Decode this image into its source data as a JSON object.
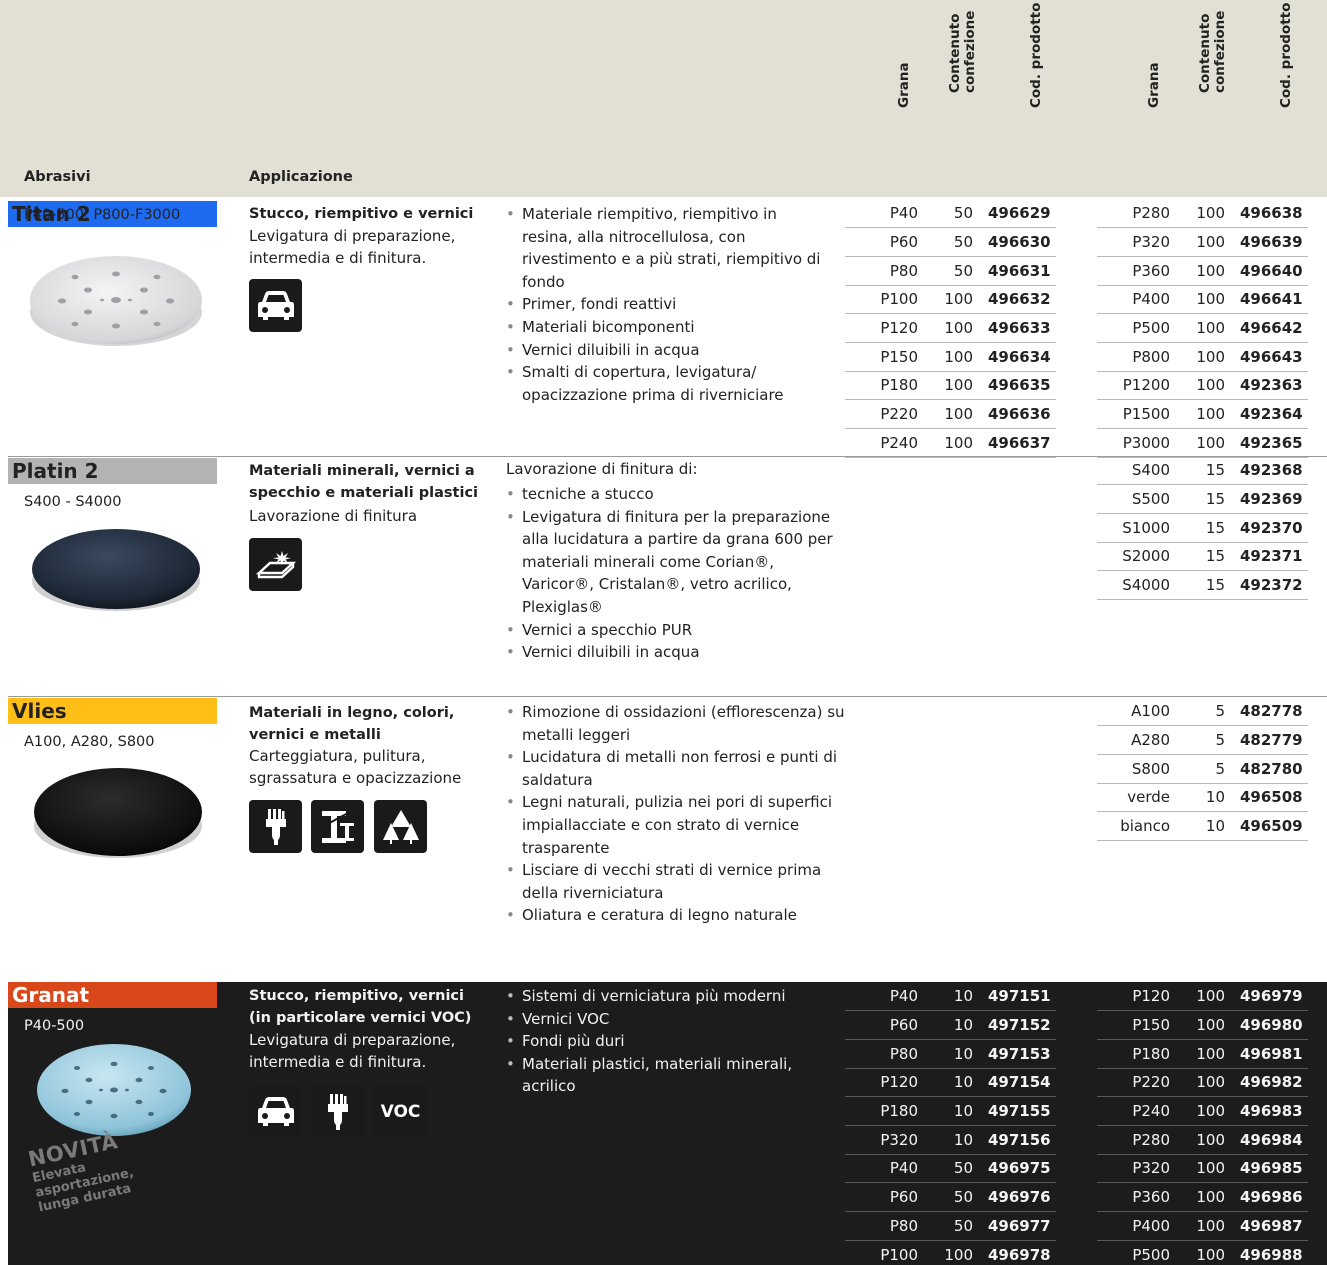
{
  "header": {
    "group1": {
      "grana": "Grana",
      "contenuto": "Contenuto\nconfezione",
      "codice": "Cod. prodotto"
    },
    "group2": {
      "grana": "Grana",
      "contenuto": "Contenuto\nconfezione",
      "codice": "Cod. prodotto"
    },
    "col_abrasivi": "Abrasivi",
    "col_applicazione": "Applicazione"
  },
  "colors": {
    "header_bg": "#e2e0d5",
    "titan_accent": "#1f6bf0",
    "platin_accent": "#b3b3b3",
    "vlies_accent": "#ffbf17",
    "granat_accent": "#d8481b",
    "granat_bg": "#1c1c1c"
  },
  "products": {
    "titan": {
      "name": "Titan 2",
      "grit_range": "P40-500, P800-F3000",
      "app_title": "Stucco, riempitivo e vernici",
      "app_desc": "Levigatura di preparazione, intermedia e di finitura.",
      "icons": [
        "car-icon"
      ],
      "bullets": [
        "Materiale riempitivo, riempitivo in resina, alla nitrocellulosa, con rivestimento e a più strati, riempitivo di fondo",
        "Primer, fondi reattivi",
        "Materiali bicomponenti",
        "Vernici diluibili in acqua",
        "Smalti di copertura, levigatura/ opacizzazione prima di riverniciare"
      ],
      "rows_left": [
        [
          "P40",
          "50",
          "496629"
        ],
        [
          "P60",
          "50",
          "496630"
        ],
        [
          "P80",
          "50",
          "496631"
        ],
        [
          "P100",
          "100",
          "496632"
        ],
        [
          "P120",
          "100",
          "496633"
        ],
        [
          "P150",
          "100",
          "496634"
        ],
        [
          "P180",
          "100",
          "496635"
        ],
        [
          "P220",
          "100",
          "496636"
        ],
        [
          "P240",
          "100",
          "496637"
        ]
      ],
      "rows_right": [
        [
          "P280",
          "100",
          "496638"
        ],
        [
          "P320",
          "100",
          "496639"
        ],
        [
          "P360",
          "100",
          "496640"
        ],
        [
          "P400",
          "100",
          "496641"
        ],
        [
          "P500",
          "100",
          "496642"
        ],
        [
          "P800",
          "100",
          "496643"
        ],
        [
          "P1200",
          "100",
          "492363"
        ],
        [
          "P1500",
          "100",
          "492364"
        ],
        [
          "P3000",
          "100",
          "492365"
        ]
      ]
    },
    "platin": {
      "name": "Platin 2",
      "grit_range": "S400 - S4000",
      "app_title": "Materiali minerali, vernici a specchio e materiali plastici",
      "app_desc": "Lavorazione di finitura",
      "icons": [
        "polish-surface-icon"
      ],
      "intro": "Lavorazione di finitura di:",
      "bullets": [
        "tecniche a stucco",
        "Levigatura di finitura per la preparazione alla lucidatura a partire da grana 600 per materiali minerali come Corian®, Varicor®, Cristalan®, vetro acrilico, Plexiglas®",
        "Vernici a specchio PUR",
        "Vernici diluibili in acqua"
      ],
      "rows_right": [
        [
          "S400",
          "15",
          "492368"
        ],
        [
          "S500",
          "15",
          "492369"
        ],
        [
          "S1000",
          "15",
          "492370"
        ],
        [
          "S2000",
          "15",
          "492371"
        ],
        [
          "S4000",
          "15",
          "492372"
        ]
      ]
    },
    "vlies": {
      "name": "Vlies",
      "grit_range": "A100, A280, S800",
      "app_title": "Materiali in legno, colori, vernici e metalli",
      "app_desc": "Carteggiatura, pulitura, sgrassatura e opacizzazione",
      "icons": [
        "paintbrush-icon",
        "metal-beam-icon",
        "wood-trees-icon"
      ],
      "bullets": [
        "Rimozione di ossidazioni (efflorescenza) su metalli leggeri",
        "Lucidatura di metalli non ferrosi e punti di saldatura",
        "Legni naturali, pulizia nei pori di superfici impiallacciate e con strato di vernice trasparente",
        "Lisciare di vecchi strati di vernice prima della riverniciatura",
        "Oliatura e ceratura di legno naturale"
      ],
      "rows_right": [
        [
          "A100",
          "5",
          "482778"
        ],
        [
          "A280",
          "5",
          "482779"
        ],
        [
          "S800",
          "5",
          "482780"
        ],
        [
          "verde",
          "10",
          "496508"
        ],
        [
          "bianco",
          "10",
          "496509"
        ]
      ]
    },
    "granat": {
      "name": "Granat",
      "grit_range": "P40-500",
      "app_title": "Stucco, riempitivo, vernici (in particolare vernici VOC)",
      "app_desc": "Levigatura di preparazione, intermedia e di finitura.",
      "icons": [
        "car-icon",
        "paintbrush-icon",
        "voc-icon"
      ],
      "voc_label": "VOC",
      "novita": "NOVITÀ",
      "novita_sub1": "Elevata",
      "novita_sub2": "asportazione,",
      "novita_sub3": "lunga durata",
      "bullets": [
        "Sistemi di verniciatura più moderni",
        "Vernici VOC",
        "Fondi più duri",
        "Materiali plastici, materiali minerali, acrilico"
      ],
      "rows_left": [
        [
          "P40",
          "10",
          "497151"
        ],
        [
          "P60",
          "10",
          "497152"
        ],
        [
          "P80",
          "10",
          "497153"
        ],
        [
          "P120",
          "10",
          "497154"
        ],
        [
          "P180",
          "10",
          "497155"
        ],
        [
          "P320",
          "10",
          "497156"
        ],
        [
          "P40",
          "50",
          "496975"
        ],
        [
          "P60",
          "50",
          "496976"
        ],
        [
          "P80",
          "50",
          "496977"
        ],
        [
          "P100",
          "100",
          "496978"
        ]
      ],
      "rows_right": [
        [
          "P120",
          "100",
          "496979"
        ],
        [
          "P150",
          "100",
          "496980"
        ],
        [
          "P180",
          "100",
          "496981"
        ],
        [
          "P220",
          "100",
          "496982"
        ],
        [
          "P240",
          "100",
          "496983"
        ],
        [
          "P280",
          "100",
          "496984"
        ],
        [
          "P320",
          "100",
          "496985"
        ],
        [
          "P360",
          "100",
          "496986"
        ],
        [
          "P400",
          "100",
          "496987"
        ],
        [
          "P500",
          "100",
          "496988"
        ]
      ]
    }
  }
}
